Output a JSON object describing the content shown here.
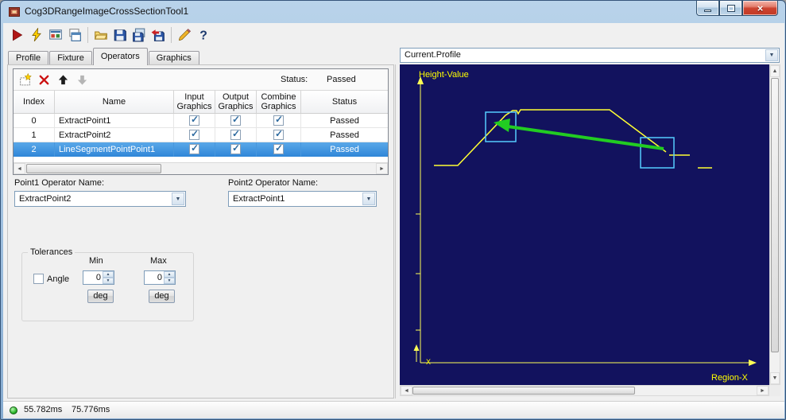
{
  "window": {
    "title": "Cog3DRangeImageCrossSectionTool1"
  },
  "toolbar": {
    "items": [
      "run-icon",
      "run-live-icon",
      "display-icon",
      "new-window-icon",
      "open-icon",
      "save-icon",
      "save-all-icon",
      "import-icon",
      "wizard-icon",
      "help-icon"
    ]
  },
  "tabs": [
    {
      "label": "Profile"
    },
    {
      "label": "Fixture"
    },
    {
      "label": "Operators"
    },
    {
      "label": "Graphics"
    }
  ],
  "operators": {
    "grid_toolbar": {
      "status_label": "Status:",
      "status_value": "Passed"
    },
    "table": {
      "headers": [
        "Index",
        "Name",
        "Input\nGraphics",
        "Output\nGraphics",
        "Combine\nGraphics",
        "Status"
      ],
      "rows": [
        {
          "index": "0",
          "name": "ExtractPoint1",
          "input_graphics": true,
          "output_graphics": true,
          "combine_graphics": true,
          "status": "Passed",
          "selected": false
        },
        {
          "index": "1",
          "name": "ExtractPoint2",
          "input_graphics": true,
          "output_graphics": true,
          "combine_graphics": true,
          "status": "Passed",
          "selected": false
        },
        {
          "index": "2",
          "name": "LineSegmentPointPoint1",
          "input_graphics": true,
          "output_graphics": true,
          "combine_graphics": true,
          "status": "Passed",
          "selected": true
        }
      ]
    },
    "point1": {
      "label": "Point1 Operator Name:",
      "value": "ExtractPoint2"
    },
    "point2": {
      "label": "Point2 Operator Name:",
      "value": "ExtractPoint1"
    },
    "tolerances": {
      "title": "Tolerances",
      "angle_label": "Angle",
      "angle_checked": false,
      "min_label": "Min",
      "min_value": "0",
      "min_unit": "deg",
      "max_label": "Max",
      "max_value": "0",
      "max_unit": "deg"
    }
  },
  "display": {
    "source_selector": "Current.Profile",
    "y_axis_label": "Height-Value",
    "x_axis_label": "Region-X",
    "origin_label": "X",
    "colors": {
      "background": "#12125e",
      "profile": "#ffff33",
      "marker": "#55ccff",
      "arrow": "#22cc22",
      "axis": "#ffff55"
    }
  },
  "status_bar": {
    "time1": "55.782ms",
    "time2": "75.776ms"
  }
}
